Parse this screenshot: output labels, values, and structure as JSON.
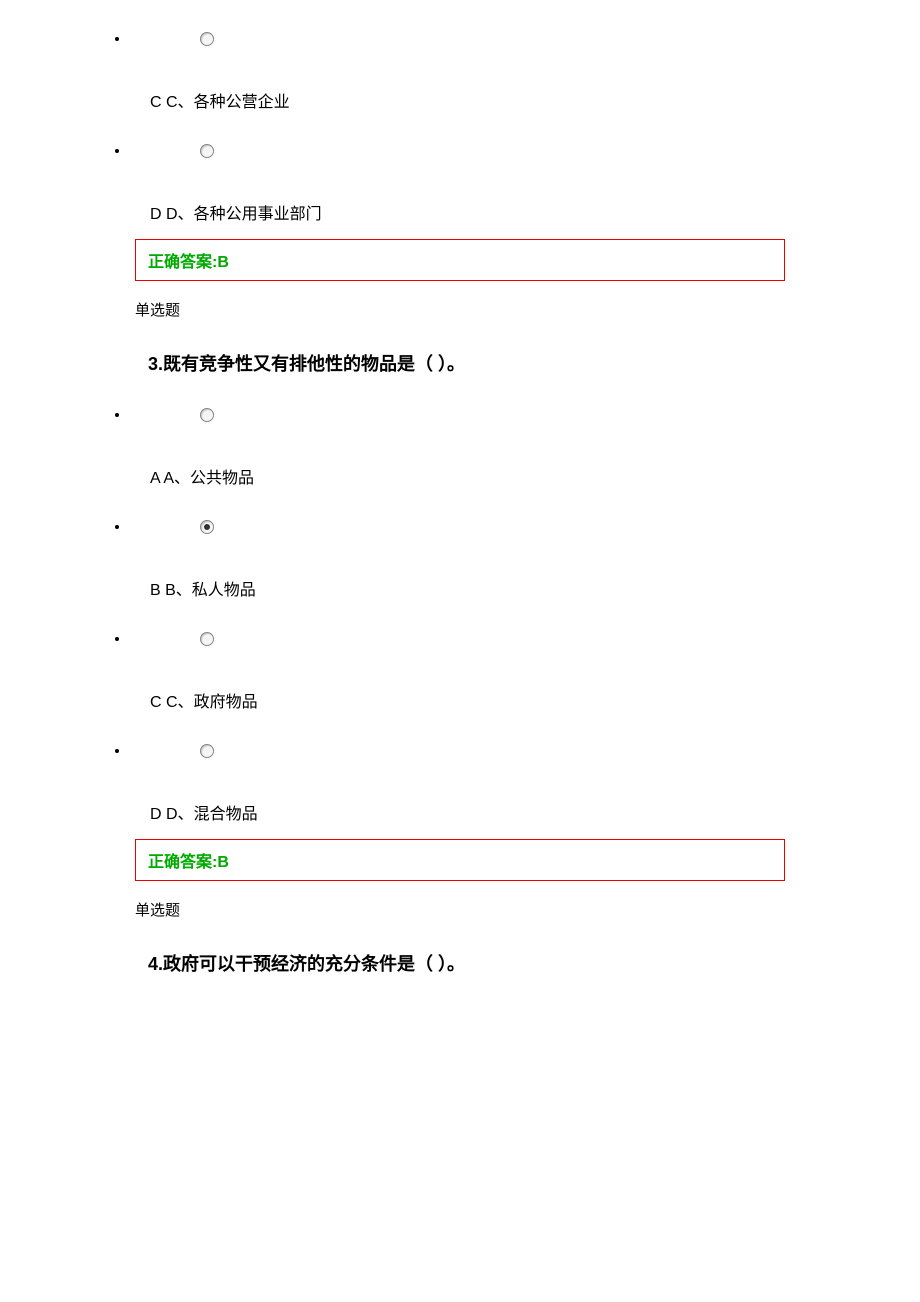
{
  "q2": {
    "options": [
      {
        "letter": "C C、",
        "text": "各种公营企业",
        "selected": false
      },
      {
        "letter": "D D、",
        "text": "各种公用事业部门",
        "selected": false
      }
    ],
    "answer_label": "正确答案:",
    "answer_value": "B",
    "type": "单选题"
  },
  "q3": {
    "number": "3.",
    "title": "既有竞争性又有排他性的物品是（ ）。",
    "options": [
      {
        "letter": "A A、",
        "text": "公共物品",
        "selected": false
      },
      {
        "letter": "B B、",
        "text": "私人物品",
        "selected": true
      },
      {
        "letter": "C C、",
        "text": "政府物品",
        "selected": false
      },
      {
        "letter": "D D、",
        "text": "混合物品",
        "selected": false
      }
    ],
    "answer_label": "正确答案:",
    "answer_value": "B",
    "type": "单选题"
  },
  "q4": {
    "number": "4.",
    "title": "政府可以干预经济的充分条件是（ ）。"
  }
}
